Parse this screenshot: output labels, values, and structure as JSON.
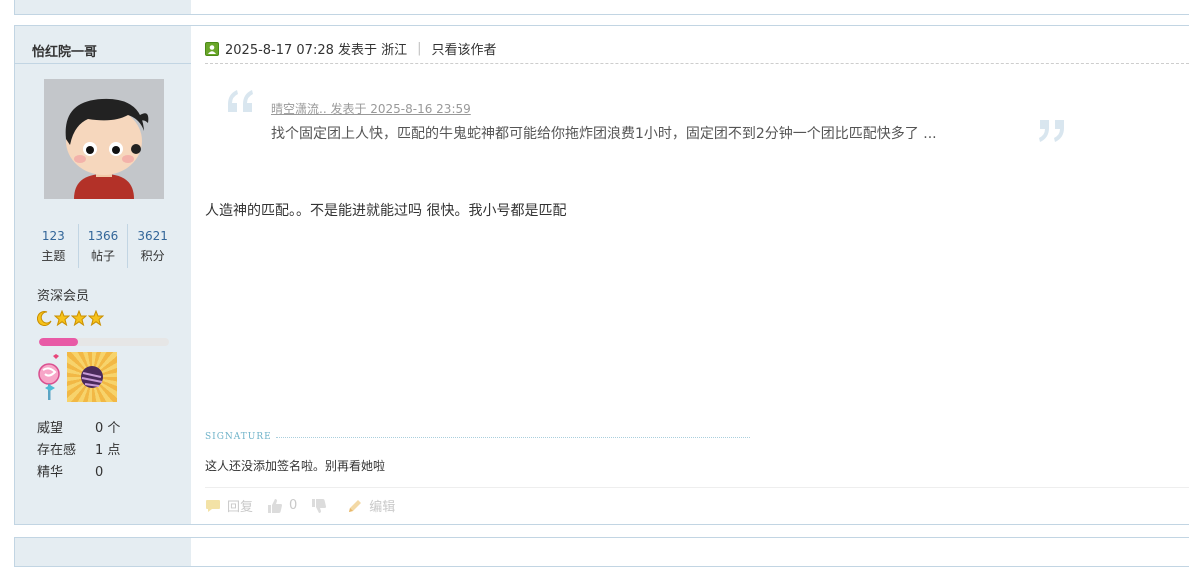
{
  "post": {
    "author": "怡红院一哥",
    "stats": [
      {
        "value": "123",
        "label": "主题"
      },
      {
        "value": "1366",
        "label": "帖子"
      },
      {
        "value": "3621",
        "label": "积分"
      }
    ],
    "group": "资深会员",
    "level_progress": 0.3,
    "info": [
      {
        "key": "威望",
        "value": "0 个"
      },
      {
        "key": "存在感",
        "value": "1 点"
      },
      {
        "key": "精华",
        "value": "0"
      }
    ],
    "header": {
      "datetime": "2025-8-17 07:28 发表于 浙江",
      "separator": "|",
      "only_author": "只看该作者"
    },
    "quote": {
      "meta": "晴空潇流.. 发表于 2025-8-16 23:59",
      "text": "找个固定团上人快，匹配的牛鬼蛇神都可能给你拖炸团浪费1小时，固定团不到2分钟一个团比匹配快多了 ..."
    },
    "body": "人造神的匹配。。不是能进就能过吗 很快。我小号都是匹配",
    "signature": {
      "title": "SIGNATURE",
      "text": "这人还没添加签名啦。别再看她啦"
    },
    "actions": {
      "reply": "回复",
      "like_count": "0",
      "edit": "编辑"
    }
  },
  "colors": {
    "sidebar_bg": "#e5edf2",
    "border": "#c2d5e3",
    "link": "#336699",
    "progress": "#e85aa6",
    "quote_mark": "#d9e6ef"
  }
}
